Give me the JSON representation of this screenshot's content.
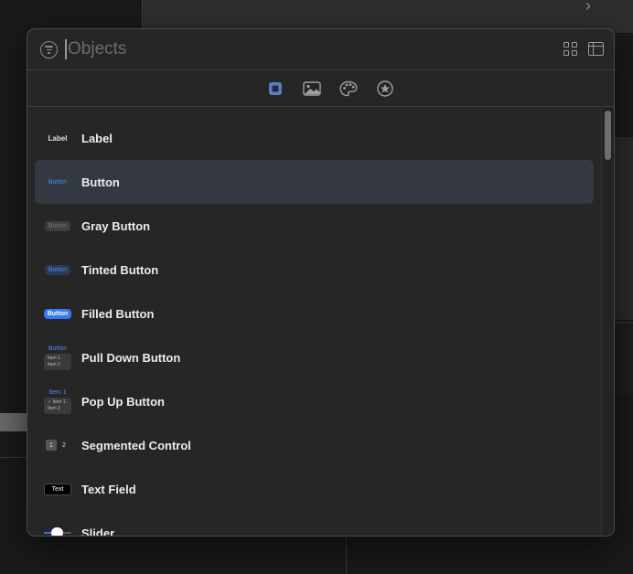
{
  "search": {
    "placeholder": "Objects",
    "value": ""
  },
  "tabs": [
    {
      "name": "objects-tab",
      "icon": "square-in-square-icon",
      "selected": true
    },
    {
      "name": "media-tab",
      "icon": "photo-icon",
      "selected": false
    },
    {
      "name": "colors-tab",
      "icon": "palette-icon",
      "selected": false
    },
    {
      "name": "symbols-tab",
      "icon": "star-circle-icon",
      "selected": false
    }
  ],
  "items": [
    {
      "label": "Label",
      "thumb": "Label"
    },
    {
      "label": "Button",
      "thumb": "Button"
    },
    {
      "label": "Gray Button",
      "thumb": "Button"
    },
    {
      "label": "Tinted Button",
      "thumb": "Button"
    },
    {
      "label": "Filled Button",
      "thumb": "Button"
    },
    {
      "label": "Pull Down Button",
      "thumb": "Button",
      "thumb_items": [
        "Item 1",
        "Item 2"
      ]
    },
    {
      "label": "Pop Up Button",
      "thumb": "Item 1",
      "thumb_items": [
        "✓ Item 1",
        "Item 2"
      ]
    },
    {
      "label": "Segmented Control",
      "thumb_items": [
        "1",
        "2"
      ]
    },
    {
      "label": "Text Field",
      "thumb": "Text"
    },
    {
      "label": "Slider",
      "thumb": ""
    }
  ],
  "selected_index": 1,
  "colors": {
    "accent": "#3478f6",
    "selection": "#343840",
    "panel": "#262626"
  }
}
